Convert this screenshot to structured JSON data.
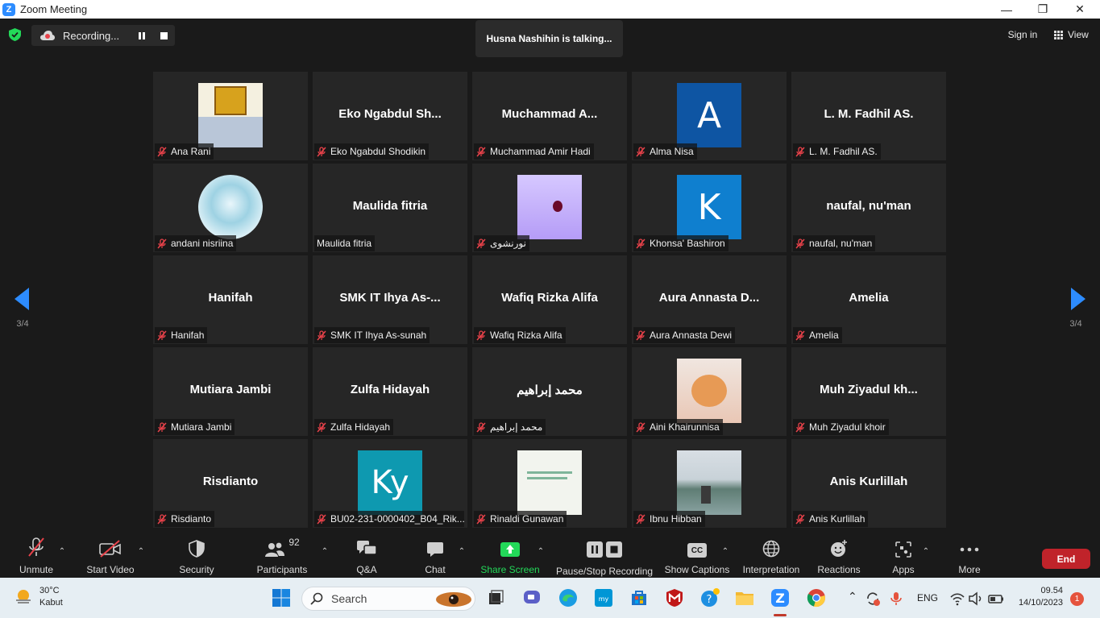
{
  "window": {
    "title": "Zoom Meeting",
    "minimize_glyph": "—",
    "restore_glyph": "❐",
    "close_glyph": "✕",
    "logo_letter": "Z"
  },
  "topbar": {
    "recording_label": "Recording...",
    "talking_label": "Husna Nashihin is talking...",
    "signin_label": "Sign in",
    "view_label": "View"
  },
  "pager": {
    "left_label": "3/4",
    "right_label": "3/4"
  },
  "tiles": [
    {
      "big": "",
      "name": "Ana Rani",
      "avatar": "image"
    },
    {
      "big": "Eko  Ngabdul  Sh...",
      "name": "Eko Ngabdul Shodikin"
    },
    {
      "big": "Muchammad  A...",
      "name": "Muchammad Amir Hadi"
    },
    {
      "big": "",
      "name": "Alma Nisa",
      "avatar": "letter",
      "letter": "A",
      "color": "#0e55a3"
    },
    {
      "big": "L. M. Fadhil AS.",
      "name": "L. M. Fadhil AS."
    },
    {
      "big": "",
      "name": "andani nisriina",
      "avatar": "image"
    },
    {
      "big": "Maulida fitria",
      "name": "Maulida fitria",
      "nomic": true
    },
    {
      "big": "",
      "name": "نورنشوى",
      "avatar": "image"
    },
    {
      "big": "",
      "name": "Khonsa' Bashiron",
      "avatar": "letter",
      "letter": "K",
      "color": "#0f7fcf"
    },
    {
      "big": "naufal, nu'man",
      "name": "naufal, nu'man"
    },
    {
      "big": "Hanifah",
      "name": "Hanifah"
    },
    {
      "big": "SMK IT Ihya As-...",
      "name": "SMK IT Ihya As-sunah"
    },
    {
      "big": "Wafiq Rizka Alifa",
      "name": "Wafiq Rizka Alifa"
    },
    {
      "big": "Aura Annasta D...",
      "name": "Aura Annasta Dewi"
    },
    {
      "big": "Amelia",
      "name": "Amelia"
    },
    {
      "big": "Mutiara Jambi",
      "name": "Mutiara Jambi"
    },
    {
      "big": "Zulfa Hidayah",
      "name": "Zulfa Hidayah"
    },
    {
      "big": "محمد إبراهيم",
      "name": "محمد إبراهيم"
    },
    {
      "big": "",
      "name": "Aini Khairunnisa",
      "avatar": "image"
    },
    {
      "big": "Muh  Ziyadul  kh...",
      "name": "Muh Ziyadul khoir"
    },
    {
      "big": "Risdianto",
      "name": "Risdianto"
    },
    {
      "big": "",
      "name": "BU02-231-0000402_B04_Rik...",
      "avatar": "letter",
      "letter": "Ky",
      "color": "#0e99b0"
    },
    {
      "big": "",
      "name": "Rinaldi Gunawan",
      "avatar": "image"
    },
    {
      "big": "",
      "name": "Ibnu Hibban",
      "avatar": "image"
    },
    {
      "big": "Anis Kurlillah",
      "name": "Anis Kurlillah"
    }
  ],
  "toolbar": {
    "unmute": "Unmute",
    "start_video": "Start Video",
    "security": "Security",
    "participants": "Participants",
    "participant_count": "92",
    "qa": "Q&A",
    "chat": "Chat",
    "share_screen": "Share Screen",
    "pause_stop": "Pause/Stop Recording",
    "show_captions": "Show Captions",
    "captions_badge": "CC",
    "interpretation": "Interpretation",
    "reactions": "Reactions",
    "apps": "Apps",
    "more": "More",
    "end": "End",
    "caret_glyph": "⌃"
  },
  "taskbar": {
    "temperature": "30°C",
    "weather": "Kabut",
    "search_label": "Search",
    "lang": "ENG",
    "time": "09.54",
    "date": "14/10/2023",
    "notifications": "1"
  },
  "colors": {
    "accent_green": "#23d959",
    "end_red": "#c0232a",
    "mic_red": "#e8424a",
    "zoom_blue": "#2d8cff"
  }
}
